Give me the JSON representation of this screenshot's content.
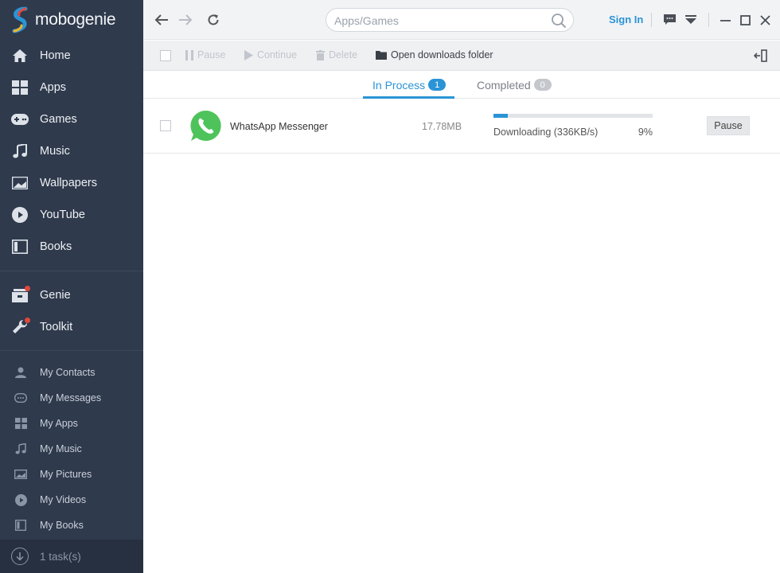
{
  "app": {
    "name": "mobogenie"
  },
  "sidebar": {
    "main_items": [
      {
        "label": "Home",
        "icon": "home-icon"
      },
      {
        "label": "Apps",
        "icon": "apps-grid-icon"
      },
      {
        "label": "Games",
        "icon": "gamepad-icon"
      },
      {
        "label": "Music",
        "icon": "music-note-icon"
      },
      {
        "label": "Wallpapers",
        "icon": "wallpaper-icon"
      },
      {
        "label": "YouTube",
        "icon": "play-circle-icon"
      },
      {
        "label": "Books",
        "icon": "book-icon"
      }
    ],
    "extra_items": [
      {
        "label": "Genie",
        "icon": "genie-icon"
      },
      {
        "label": "Toolkit",
        "icon": "wrench-icon"
      }
    ],
    "sub_items": [
      {
        "label": "My Contacts",
        "icon": "contact-icon"
      },
      {
        "label": "My Messages",
        "icon": "message-icon"
      },
      {
        "label": "My Apps",
        "icon": "apps-grid-icon"
      },
      {
        "label": "My Music",
        "icon": "music-note-icon"
      },
      {
        "label": "My Pictures",
        "icon": "picture-icon"
      },
      {
        "label": "My Videos",
        "icon": "play-circle-icon"
      },
      {
        "label": "My Books",
        "icon": "book-icon"
      }
    ],
    "footer": {
      "label": "1 task(s)"
    }
  },
  "header": {
    "search_placeholder": "Apps/Games",
    "signin_label": "Sign In"
  },
  "toolbar": {
    "pause_label": "Pause",
    "continue_label": "Continue",
    "delete_label": "Delete",
    "open_folder_label": "Open downloads folder"
  },
  "tabs": [
    {
      "label": "In Process",
      "count": "1"
    },
    {
      "label": "Completed",
      "count": "0"
    }
  ],
  "downloads": [
    {
      "name": "WhatsApp Messenger",
      "size": "17.78MB",
      "status": "Downloading (336KB/s)",
      "percent_label": "9%",
      "progress": 0.09,
      "action_label": "Pause"
    }
  ],
  "colors": {
    "sidebar_bg": "#2f3a4c",
    "accent": "#2a94d6",
    "notification_dot": "#e2483d",
    "whatsapp_green": "#4fc35b"
  }
}
